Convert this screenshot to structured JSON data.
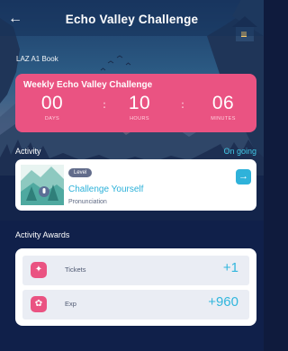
{
  "header": {
    "title": "Echo Valley Challenge",
    "back_icon": "arrow-left-icon"
  },
  "book_label": "LAZ A1 Book",
  "countdown": {
    "title": "Weekly Echo Valley Challenge",
    "days": "00",
    "days_label": "DAYS",
    "hours": "10",
    "hours_label": "HOURS",
    "minutes": "06",
    "minutes_label": "MINUTES",
    "separator": ":"
  },
  "activity": {
    "label": "Activity",
    "status": "On going",
    "badge": "Level",
    "title": "Challenge Yourself",
    "subtitle": "Pronunciation",
    "go_icon": "arrow-right-icon"
  },
  "awards": {
    "label": "Activity Awards",
    "items": [
      {
        "name": "Tickets",
        "value": "+1",
        "icon": "ticket-icon"
      },
      {
        "name": "Exp",
        "value": "+960",
        "icon": "medal-icon"
      }
    ]
  },
  "colors": {
    "accent_pink": "#ea5382",
    "accent_blue": "#2fb2da",
    "background": "#10204a"
  }
}
